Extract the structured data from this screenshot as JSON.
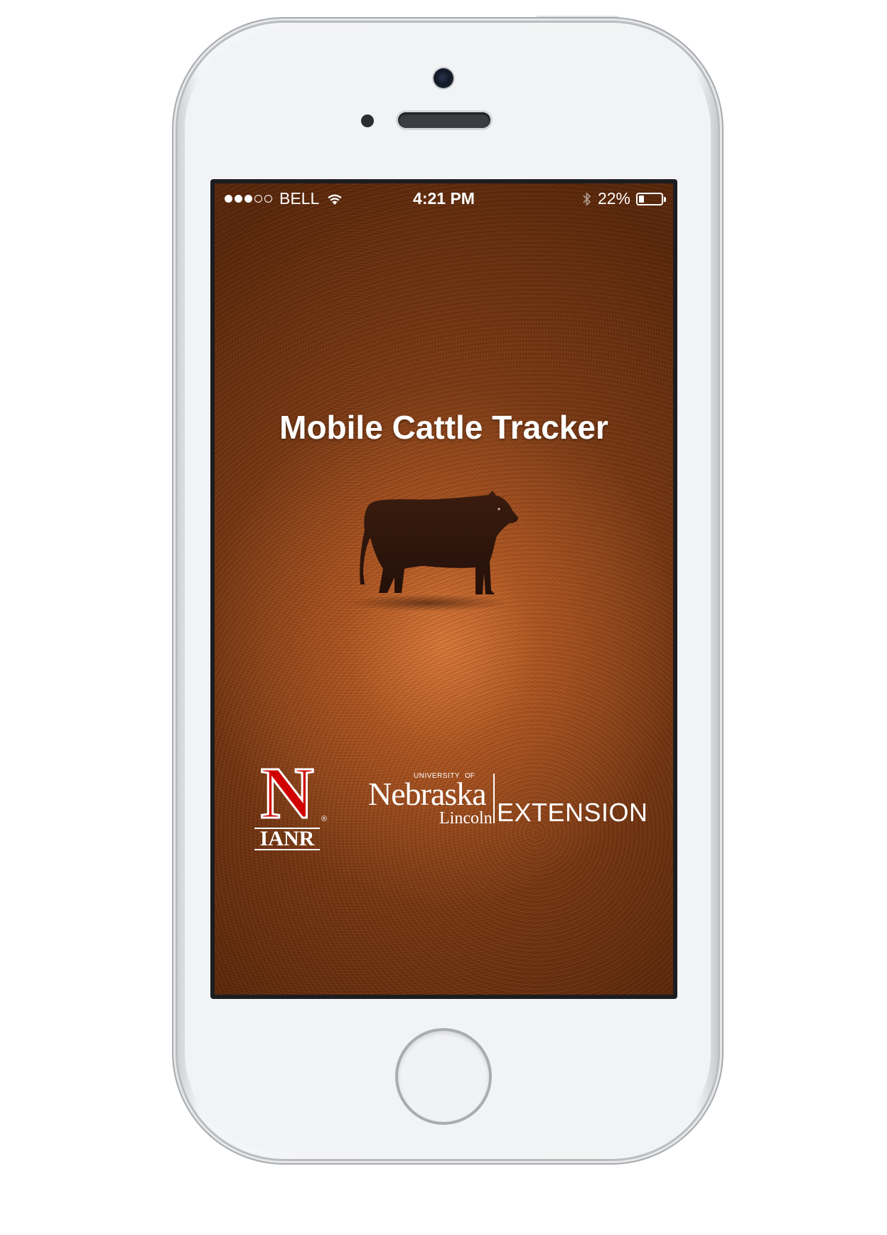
{
  "status_bar": {
    "carrier": "BELL",
    "time": "4:21 PM",
    "battery_percent": "22%",
    "battery_level": 0.22,
    "signal_bars_filled": 3,
    "signal_bars_total": 5,
    "icons": [
      "wifi-icon",
      "bluetooth-icon",
      "battery-icon"
    ]
  },
  "app": {
    "title": "Mobile Cattle Tracker",
    "hero_icon": "cow-icon"
  },
  "logos": {
    "ianr": {
      "letter": "N",
      "text": "IANR",
      "mark": "®"
    },
    "unl": {
      "university": "UNIVERSITY",
      "of": "OF",
      "name": "Nebraska",
      "campus": "Lincoln",
      "extension": "EXTENSION"
    }
  },
  "colors": {
    "ianr_red": "#d00000",
    "leather_brown": "#7a3812",
    "text": "#ffffff"
  }
}
